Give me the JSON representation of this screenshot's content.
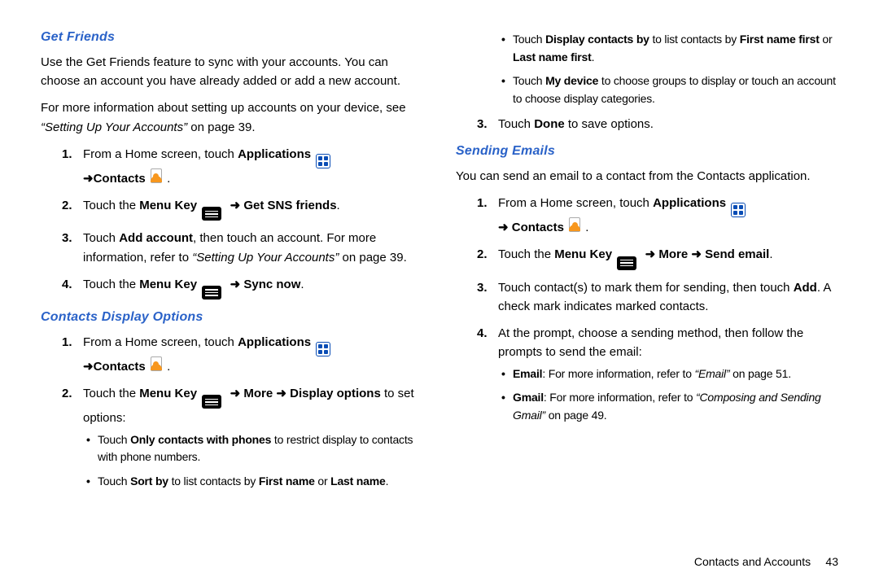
{
  "left": {
    "h1": "Get Friends",
    "p1a": "Use the Get Friends feature to sync with your accounts. You can choose an account you have already added or add a new account.",
    "p1b_a": "For more information about setting up accounts on your device, see ",
    "p1b_i": "“Setting Up Your Accounts”",
    "p1b_b": " on page 39.",
    "s1_a": "From a Home screen, touch ",
    "s1_b": "Applications",
    "s1_c": "Contacts",
    "s2_a": "Touch the ",
    "s2_b": "Menu Key",
    "s2_c": "Get SNS friends",
    "s3_a": "Touch ",
    "s3_b": "Add account",
    "s3_c": ", then touch an account. For more information, refer to ",
    "s3_i": "“Setting Up Your Accounts”",
    "s3_d": "  on page 39.",
    "s4_a": "Touch the ",
    "s4_b": "Menu Key",
    "s4_c": "Sync now",
    "h2": "Contacts Display Options",
    "c1_a": "From a Home screen, touch ",
    "c1_b": "Applications",
    "c1_c": "Contacts",
    "c2_a": "Touch the ",
    "c2_b": "Menu Key",
    "c2_c": "More",
    "c2_d": "Display options",
    "c2_e": " to set options:",
    "b1_a": "Touch ",
    "b1_b": "Only contacts with phones",
    "b1_c": " to restrict display to contacts with phone numbers.",
    "b2_a": "Touch ",
    "b2_b": "Sort by",
    "b2_c": " to list contacts by ",
    "b2_d": "First name",
    "b2_e": " or ",
    "b2_f": "Last name"
  },
  "right": {
    "b3_a": "Touch ",
    "b3_b": "Display contacts by",
    "b3_c": " to list contacts by ",
    "b3_d": "First name first",
    "b3_e": " or ",
    "b3_f": "Last name first",
    "b4_a": "Touch ",
    "b4_b": "My device",
    "b4_c": " to choose groups to display or touch an account to choose display categories.",
    "s3r_a": "Touch ",
    "s3r_b": "Done",
    "s3r_c": " to save options.",
    "h3": "Sending Emails",
    "p3": "You can send an email to a contact from the Contacts application.",
    "e1_a": "From a Home screen, touch ",
    "e1_b": "Applications",
    "e1_c": "Contacts",
    "e2_a": "Touch the ",
    "e2_b": "Menu Key",
    "e2_c": "More",
    "e2_d": "Send email",
    "e3_a": "Touch contact(s) to mark them for sending, then touch ",
    "e3_b": "Add",
    "e3_c": ". A check mark indicates marked contacts.",
    "e4": "At the prompt, choose a sending method, then follow the prompts to send the email:",
    "eb1_a": "Email",
    "eb1_b": ": For more information, refer to ",
    "eb1_i": "“Email”",
    "eb1_c": "  on page 51.",
    "eb2_a": "Gmail",
    "eb2_b": ": For more information, refer to ",
    "eb2_i": "“Composing and Sending Gmail”",
    "eb2_c": "  on page 49."
  },
  "footer": {
    "label": "Contacts and Accounts",
    "page": "43"
  },
  "arrow": "➜"
}
